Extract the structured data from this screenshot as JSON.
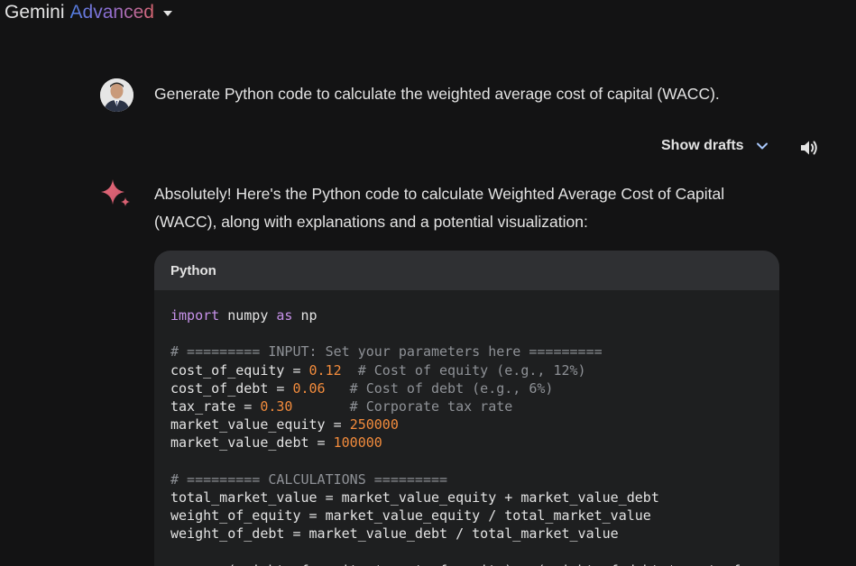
{
  "header": {
    "brand_name": "Gemini",
    "brand_tier": "Advanced"
  },
  "user_prompt": {
    "text": "Generate Python code to calculate the weighted average cost of capital (WACC)."
  },
  "drafts": {
    "label": "Show drafts"
  },
  "response": {
    "text": "Absolutely! Here's the Python code to calculate Weighted Average Cost of Capital (WACC), along with explanations and a potential visualization:"
  },
  "code_block": {
    "language": "Python",
    "lines": [
      [
        {
          "t": "import",
          "c": "kw"
        },
        {
          "t": " numpy ",
          "c": ""
        },
        {
          "t": "as",
          "c": "kw"
        },
        {
          "t": " np",
          "c": ""
        }
      ],
      [],
      [
        {
          "t": "# ========= INPUT: Set your parameters here =========",
          "c": "cm"
        }
      ],
      [
        {
          "t": "cost_of_equity = ",
          "c": ""
        },
        {
          "t": "0.12",
          "c": "num"
        },
        {
          "t": "  # Cost of equity (e.g., 12%)",
          "c": "cm"
        }
      ],
      [
        {
          "t": "cost_of_debt = ",
          "c": ""
        },
        {
          "t": "0.06",
          "c": "num"
        },
        {
          "t": "   # Cost of debt (e.g., 6%)",
          "c": "cm"
        }
      ],
      [
        {
          "t": "tax_rate = ",
          "c": ""
        },
        {
          "t": "0.30",
          "c": "num"
        },
        {
          "t": "       # Corporate tax rate",
          "c": "cm"
        }
      ],
      [
        {
          "t": "market_value_equity = ",
          "c": ""
        },
        {
          "t": "250000",
          "c": "num"
        }
      ],
      [
        {
          "t": "market_value_debt = ",
          "c": ""
        },
        {
          "t": "100000",
          "c": "num"
        }
      ],
      [],
      [
        {
          "t": "# ========= CALCULATIONS =========",
          "c": "cm"
        }
      ],
      [
        {
          "t": "total_market_value = market_value_equity + market_value_debt",
          "c": ""
        }
      ],
      [
        {
          "t": "weight_of_equity = market_value_equity / total_market_value",
          "c": ""
        }
      ],
      [
        {
          "t": "weight_of_debt = market_value_debt / total_market_value",
          "c": ""
        }
      ],
      [],
      [
        {
          "t": "wacc = (weight_of_equity * cost_of_equity) + (weight_of_debt * cost_of",
          "c": ""
        }
      ]
    ]
  },
  "colors": {
    "background": "#131314",
    "code_bg": "#1e1f20",
    "code_header_bg": "#2f3033",
    "keyword": "#c792ea",
    "number": "#f28b3c",
    "comment": "#8e9196",
    "sparkle": "#d96570"
  },
  "icons": {
    "brand_dropdown": "caret-down-icon",
    "drafts_toggle": "chevron-down-icon",
    "speaker": "speaker-icon",
    "assistant": "sparkle-icon"
  }
}
